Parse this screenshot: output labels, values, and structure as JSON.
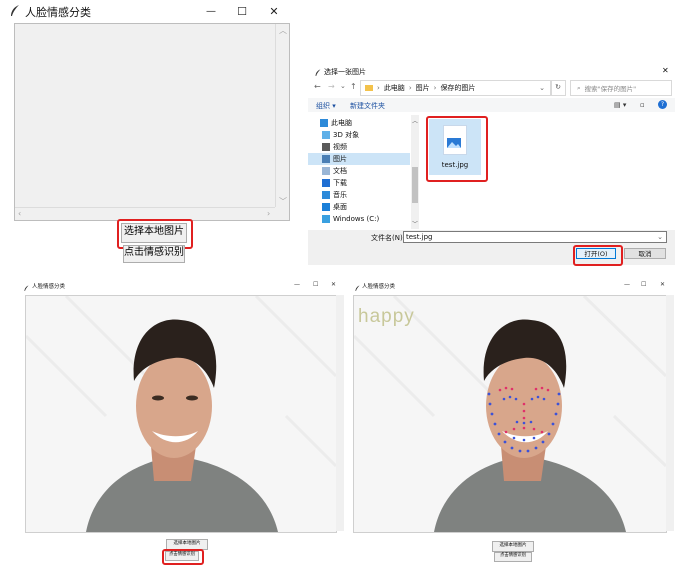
{
  "panel1": {
    "title": "人脸情感分类",
    "caption": {
      "minimize": "—",
      "maximize": "☐",
      "close": "✕"
    },
    "buttons": {
      "select_image": "选择本地图片",
      "recognize": "点击情感识别"
    }
  },
  "panel2": {
    "dialog_title": "选择一张图片",
    "close": "✕",
    "breadcrumb": [
      "此电脑",
      "图片",
      "保存的图片"
    ],
    "search_placeholder": "搜索\"保存的图片\"",
    "toolbar": {
      "organize": "组织 ▾",
      "new_folder": "新建文件夹"
    },
    "tree": [
      "此电脑",
      "3D 对象",
      "视频",
      "图片",
      "文档",
      "下载",
      "音乐",
      "桌面",
      "Windows (C:)"
    ],
    "file": {
      "name": "test.jpg"
    },
    "filename_label": "文件名(N):",
    "filename_value": "test.jpg",
    "open_button": "打开(O)",
    "cancel_button": "取消"
  },
  "panel3": {
    "title": "人脸情感分类",
    "caption": {
      "minimize": "—",
      "maximize": "☐",
      "close": "✕"
    },
    "buttons": {
      "select_image": "选择本地图片",
      "recognize": "点击情感识别"
    }
  },
  "panel4": {
    "title": "人脸情感分类",
    "caption": {
      "minimize": "—",
      "maximize": "☐",
      "close": "✕"
    },
    "emotion_label": "happy",
    "buttons": {
      "select_image": "选择本地图片",
      "recognize": "点击情感识别"
    }
  },
  "colors": {
    "highlight": "#e02020",
    "emotion_text": "#c8c89a",
    "folder": "#f3c24b",
    "file_icon": "#2a7ad5",
    "landmark_primary": "#3c52d8",
    "landmark_secondary": "#e0306a"
  }
}
